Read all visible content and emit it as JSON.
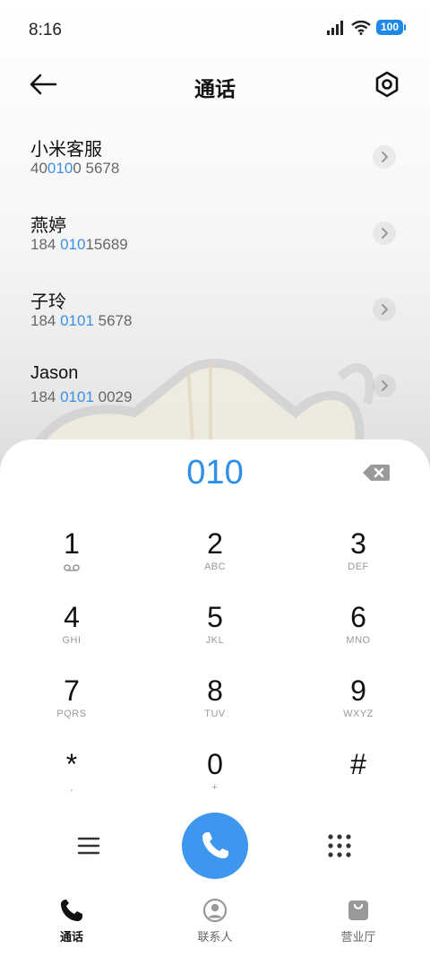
{
  "status_bar": {
    "time": "8:16",
    "battery": "100"
  },
  "header": {
    "title": "通话"
  },
  "contacts": [
    {
      "name": "小米客服",
      "phone_parts": [
        "40",
        "0",
        "",
        "10",
        "0 5678"
      ]
    },
    {
      "name": "燕婷",
      "phone_parts": [
        "184 ",
        "010",
        "15689",
        "",
        ""
      ]
    },
    {
      "name": "子玲",
      "phone_parts": [
        "184 ",
        "0101",
        " 5678",
        "",
        ""
      ]
    },
    {
      "name": "Jason",
      "phone_parts": [
        "184 ",
        "0101",
        " 0029",
        "",
        ""
      ]
    }
  ],
  "dialpad": {
    "number": "010",
    "keys": [
      {
        "digit": "1",
        "letters": "",
        "icon": "voicemail-icon"
      },
      {
        "digit": "2",
        "letters": "ABC"
      },
      {
        "digit": "3",
        "letters": "DEF"
      },
      {
        "digit": "4",
        "letters": "GHI"
      },
      {
        "digit": "5",
        "letters": "JKL"
      },
      {
        "digit": "6",
        "letters": "MNO"
      },
      {
        "digit": "7",
        "letters": "PQRS"
      },
      {
        "digit": "8",
        "letters": "TUV"
      },
      {
        "digit": "9",
        "letters": "WXYZ"
      },
      {
        "digit": "*",
        "letters": ","
      },
      {
        "digit": "0",
        "letters": "+"
      },
      {
        "digit": "#",
        "letters": ""
      }
    ]
  },
  "bottom_nav": [
    {
      "label": "通话",
      "icon": "phone-icon",
      "active": true
    },
    {
      "label": "联系人",
      "icon": "contacts-icon",
      "active": false
    },
    {
      "label": "营业厅",
      "icon": "shopping-bag-icon",
      "active": false
    }
  ],
  "colors": {
    "accent": "#3d97ee",
    "highlight": "#3b8fe5"
  }
}
